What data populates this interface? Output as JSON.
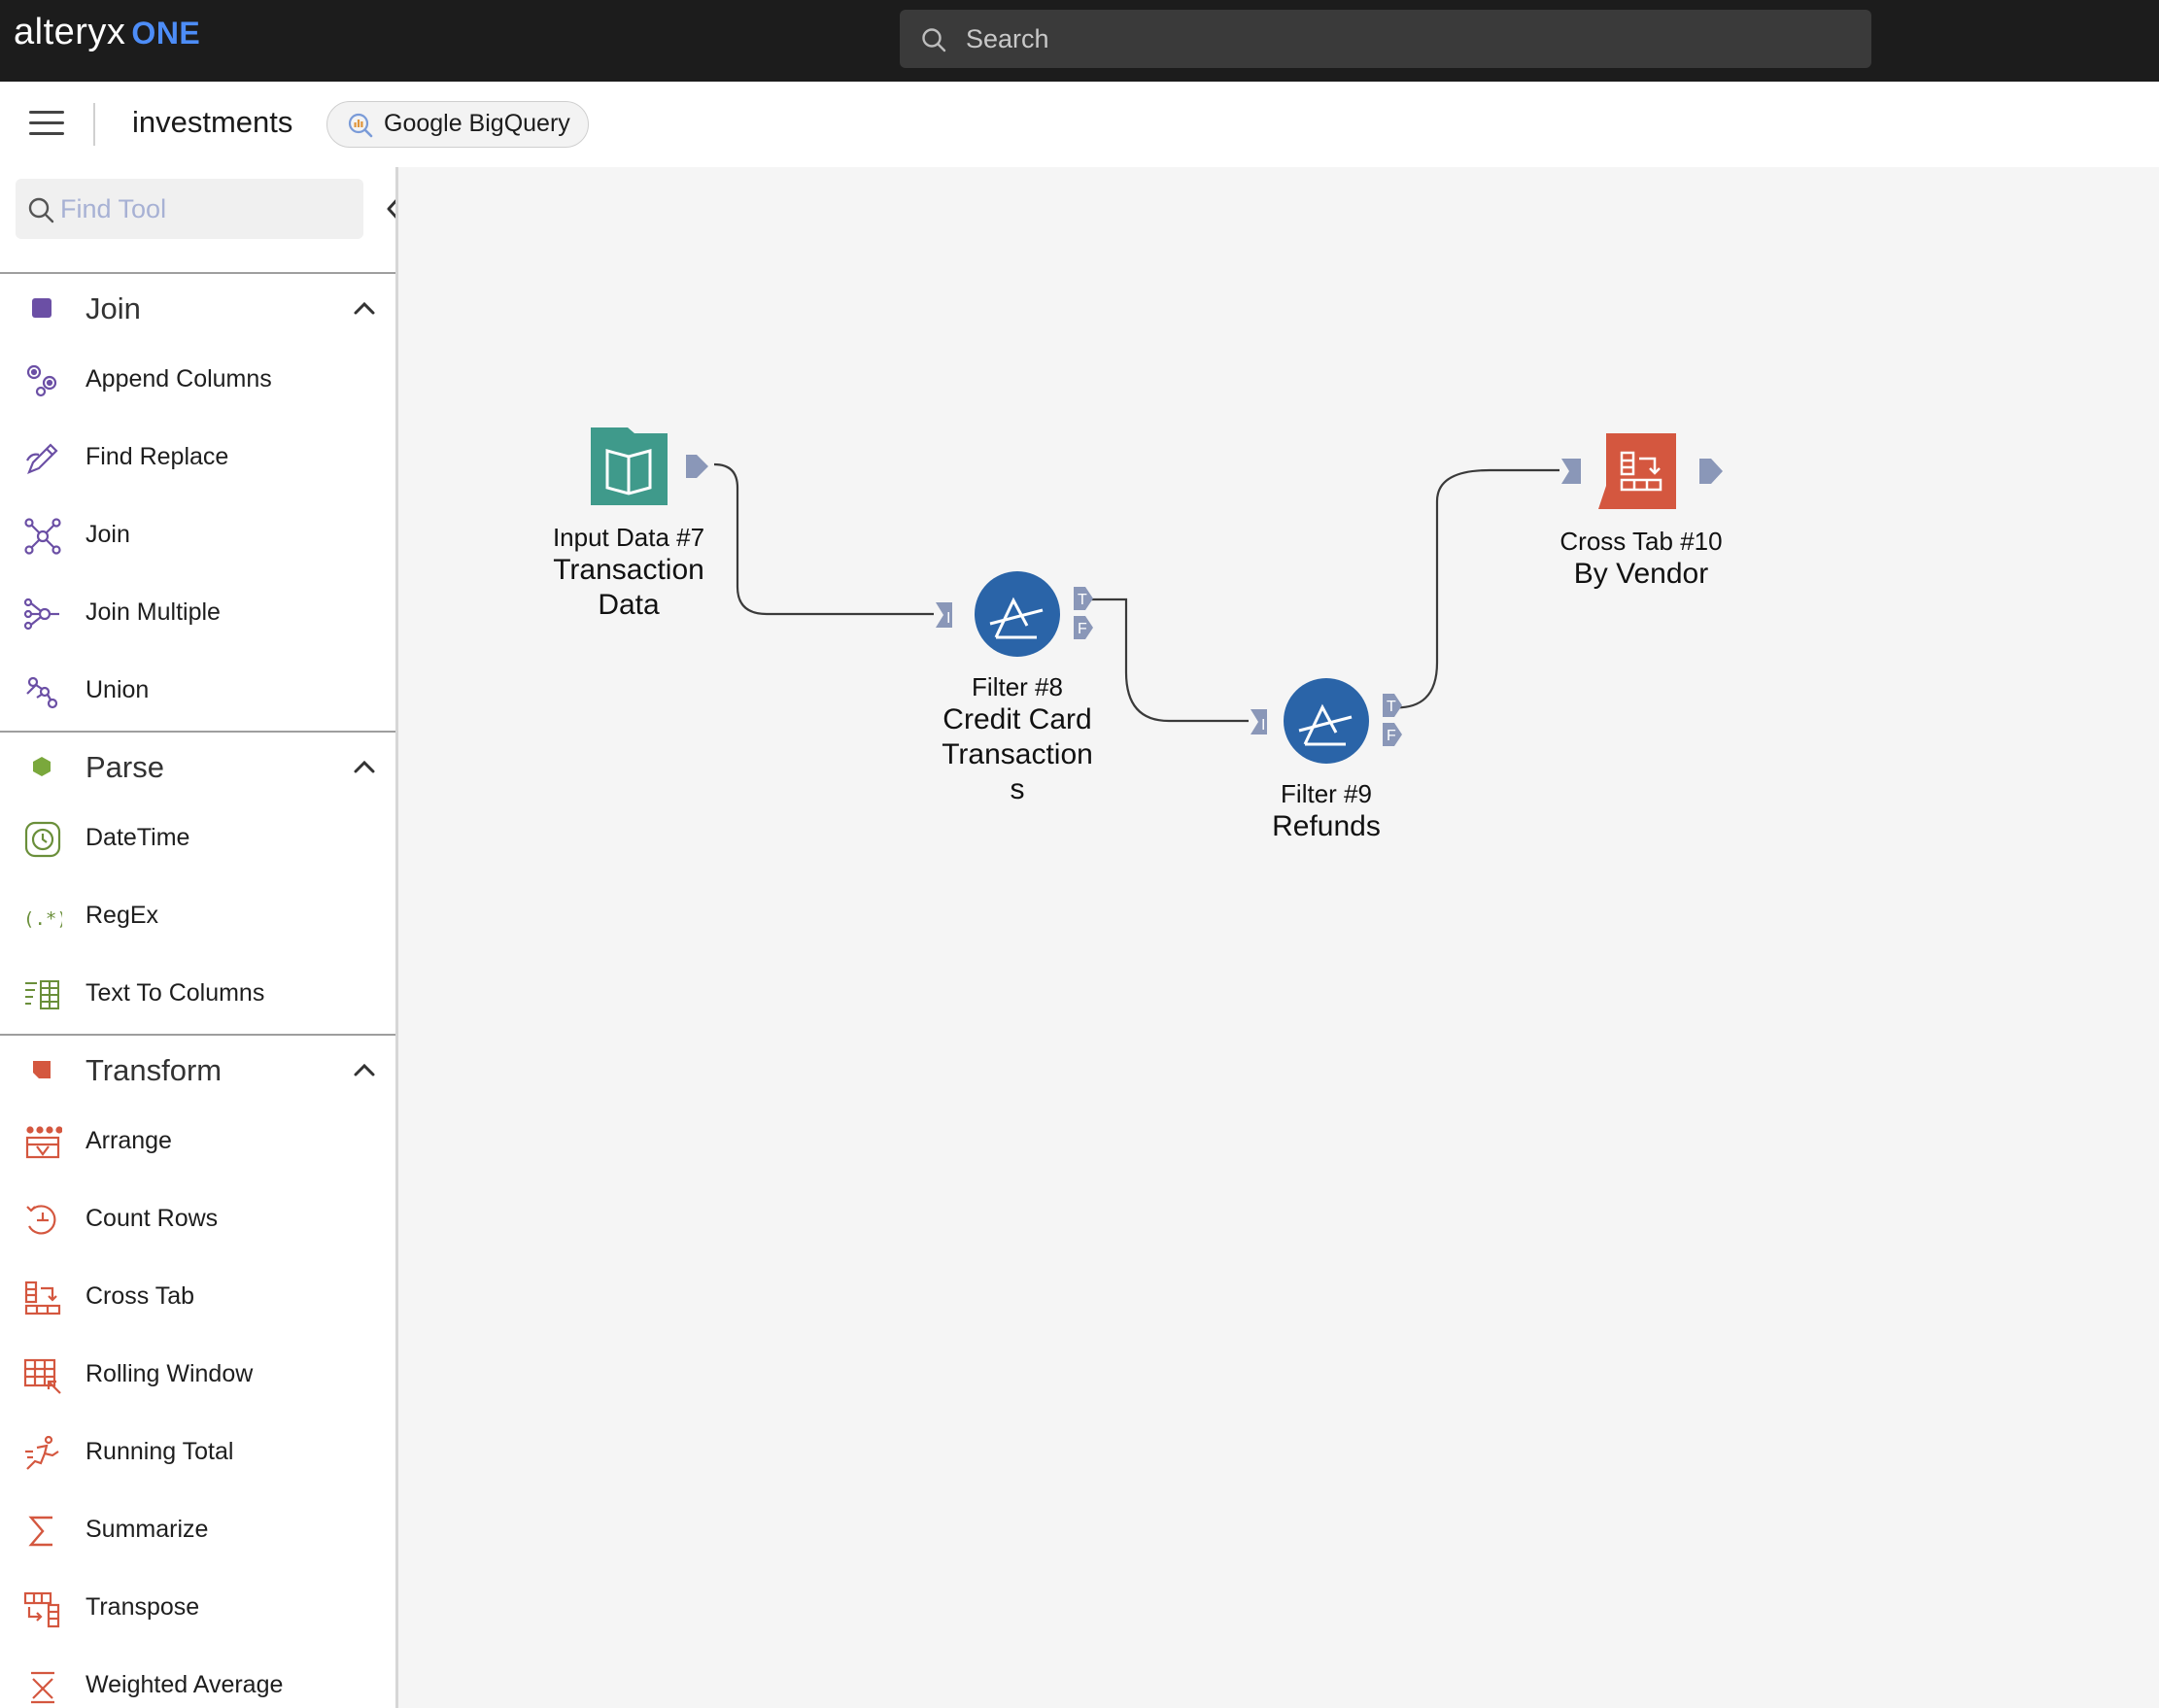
{
  "app": {
    "logo_text": "alteryx",
    "logo_suffix": "ONE",
    "search_placeholder": "Search"
  },
  "workflow": {
    "title": "investments",
    "connection": "Google BigQuery"
  },
  "sidebar": {
    "find_placeholder": "Find Tool",
    "categories": [
      {
        "label": "Join",
        "color": "#6b4fa5",
        "tools": [
          "Append Columns",
          "Find Replace",
          "Join",
          "Join Multiple",
          "Union"
        ]
      },
      {
        "label": "Parse",
        "color": "#7aa83c",
        "tools": [
          "DateTime",
          "RegEx",
          "Text To Columns"
        ]
      },
      {
        "label": "Transform",
        "color": "#d4573f",
        "tools": [
          "Arrange",
          "Count Rows",
          "Cross Tab",
          "Rolling Window",
          "Running Total",
          "Summarize",
          "Transpose",
          "Weighted Average"
        ]
      }
    ]
  },
  "canvas": {
    "nodes": [
      {
        "tag": "Input Data #7",
        "name_lines": [
          "Transaction",
          "Data"
        ],
        "color": "#3f9a8b"
      },
      {
        "tag": "Filter #8",
        "name_lines": [
          "Credit Card",
          "Transaction",
          "s"
        ],
        "color": "#2a64a8"
      },
      {
        "tag": "Filter #9",
        "name_lines": [
          "Refunds"
        ],
        "color": "#2a64a8"
      },
      {
        "tag": "Cross Tab #10",
        "name_lines": [
          "By Vendor"
        ],
        "color": "#d4573f"
      }
    ],
    "anchor_labels": {
      "input": "I",
      "true": "T",
      "false": "F"
    }
  }
}
